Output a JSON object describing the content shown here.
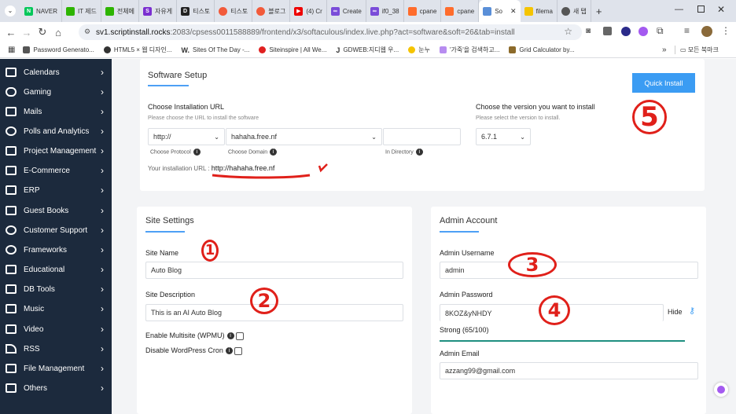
{
  "browser": {
    "tabs": [
      "NAVER",
      "IT 제드",
      "전체메",
      "자유게",
      "티스토",
      "티스토",
      "블로그",
      "(4) Cr",
      "Create",
      "if0_38",
      "cpane",
      "cpane",
      "So",
      "filema",
      "새 탭"
    ],
    "new_tab_label": "+",
    "url_host": "sv1.scriptinstall.rocks",
    "url_path": ":2083/cpsess0011588889/frontend/x3/softaculous/index.live.php?act=software&soft=26&tab=install",
    "bookmarks": [
      "Password Generato...",
      "HTML5 × 웹 디자인...",
      "Sites Of The Day -...",
      "Siteinspire | All We...",
      "GDWEB:지디웹 우...",
      "눈누",
      "'가죽'을 검색하고...",
      "Grid Calculator by..."
    ],
    "bookmarks_more": "»",
    "all_bookmarks": "모든 북마크"
  },
  "sidebar": {
    "items": [
      "Calendars",
      "Gaming",
      "Mails",
      "Polls and Analytics",
      "Project Management",
      "E-Commerce",
      "ERP",
      "Guest Books",
      "Customer Support",
      "Frameworks",
      "Educational",
      "DB Tools",
      "Music",
      "Video",
      "RSS",
      "File Management",
      "Others"
    ]
  },
  "setup": {
    "title": "Software Setup",
    "quick_install": "Quick Install",
    "url_heading": "Choose Installation URL",
    "url_sub": "Please choose the URL to install the software",
    "protocol_value": "http://",
    "domain_value": "hahaha.free.nf",
    "directory_value": "",
    "protocol_label": "Choose Protocol",
    "domain_label": "Choose Domain",
    "directory_label": "In Directory",
    "your_url_label": "Your installation URL :",
    "your_url_value": "http://hahaha.free.nf",
    "version_heading": "Choose the version you want to install",
    "version_sub": "Please select the version to install.",
    "version_value": "6.7.1"
  },
  "site_settings": {
    "title": "Site Settings",
    "name_label": "Site Name",
    "name_value": "Auto Blog",
    "desc_label": "Site Description",
    "desc_value": "This is an AI Auto Blog",
    "multisite_label": "Enable Multisite (WPMU)",
    "cron_label": "Disable WordPress Cron"
  },
  "admin": {
    "title": "Admin Account",
    "username_label": "Admin Username",
    "username_value": "admin",
    "password_label": "Admin Password",
    "password_value": "8KOZ&yNHDY",
    "hide_label": "Hide",
    "strength": "Strong (65/100)",
    "email_label": "Admin Email",
    "email_value": "azzang99@gmail.com"
  },
  "annotations": [
    "1",
    "2",
    "3",
    "4",
    "5"
  ]
}
